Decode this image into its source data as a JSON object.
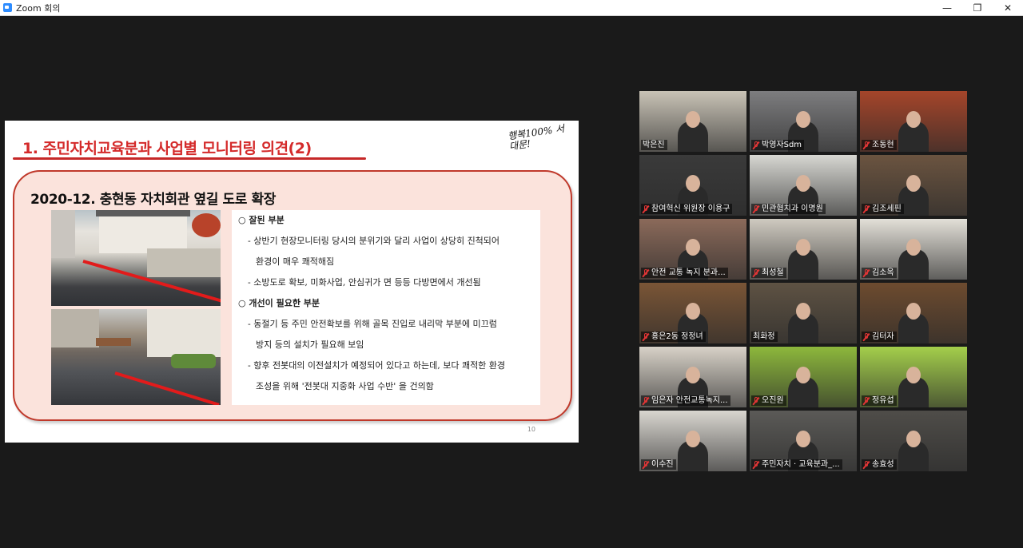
{
  "window": {
    "title": "Zoom 회의",
    "controls": {
      "minimize": "—",
      "maximize": "❐",
      "close": "✕"
    }
  },
  "slide": {
    "title": "1. 주민자치교육분과 사업별 모니터링 의견(2)",
    "logo_text": "행복100% 서대문!",
    "heading": "2020-12. 충현동 자치회관 옆길 도로 확장",
    "lines": [
      {
        "type": "h",
        "text": "○ 잘된 부분"
      },
      {
        "type": "b",
        "text": "- 상반기 현장모니터링 당시의 분위기와 달리 사업이 상당히 진척되어"
      },
      {
        "type": "c",
        "text": "환경이 매우 쾌적해짐"
      },
      {
        "type": "b",
        "text": "- 소방도로 확보, 미화사업, 안심귀가 면 등등 다방면에서 개선됨"
      },
      {
        "type": "h",
        "text": "○ 개선이 필요한 부분"
      },
      {
        "type": "b",
        "text": "- 동절기 등 주민 안전확보를 위해 골목 진입로 내리막 부분에 미끄럼"
      },
      {
        "type": "c",
        "text": "방지 등의 설치가 필요해 보임"
      },
      {
        "type": "b",
        "text": "- 향후 전봇대의 이전설치가 예정되어 있다고 하는데, 보다 쾌적한 환경"
      },
      {
        "type": "c",
        "text": "조성을 위해 '전봇대 지중화 사업 수반' 을 건의함"
      }
    ],
    "page_number": "10"
  },
  "participants": [
    {
      "name": "박은진",
      "muted": false,
      "active": true,
      "bg": "#c9c3b6"
    },
    {
      "name": "박영자Sdm",
      "muted": true,
      "active": false,
      "bg": "#7d7d7f"
    },
    {
      "name": "조동현",
      "muted": true,
      "active": false,
      "bg": "#a5452a"
    },
    {
      "name": "참여혁신 위원장 이용구",
      "muted": true,
      "active": false,
      "bg": "#3a3a3a"
    },
    {
      "name": "민관협치과 이명원",
      "muted": true,
      "active": false,
      "bg": "#d7d7d2"
    },
    {
      "name": "김조세핀",
      "muted": true,
      "active": false,
      "bg": "#6b5440"
    },
    {
      "name": "안전 교통 녹지 분과...",
      "muted": true,
      "active": false,
      "bg": "#8b6a5a"
    },
    {
      "name": "최성철",
      "muted": true,
      "active": false,
      "bg": "#cfcac0"
    },
    {
      "name": "김소옥",
      "muted": true,
      "active": false,
      "bg": "#e3e0d8"
    },
    {
      "name": "홍은2동 정정녀",
      "muted": true,
      "active": false,
      "bg": "#7a5536"
    },
    {
      "name": "최화정",
      "muted": false,
      "active": false,
      "bg": "#5e5243"
    },
    {
      "name": "김터자",
      "muted": true,
      "active": false,
      "bg": "#6d4b2f"
    },
    {
      "name": "임은자 안전교통녹지...",
      "muted": true,
      "active": false,
      "bg": "#d8d2c8"
    },
    {
      "name": "오진원",
      "muted": true,
      "active": false,
      "bg": "#8db83c"
    },
    {
      "name": "정유섭",
      "muted": true,
      "active": false,
      "bg": "#a4cf4b"
    },
    {
      "name": "이수진",
      "muted": true,
      "active": false,
      "bg": "#d9d6d0"
    },
    {
      "name": "주민자치 · 교육분과_...",
      "muted": true,
      "active": false,
      "bg": "#5b5a57"
    },
    {
      "name": "송효성",
      "muted": true,
      "active": false,
      "bg": "#4f4d49"
    }
  ],
  "colors": {
    "title_red": "#d42a2a",
    "active_speaker": "#c8e64a",
    "muted_mic": "#e03535"
  }
}
